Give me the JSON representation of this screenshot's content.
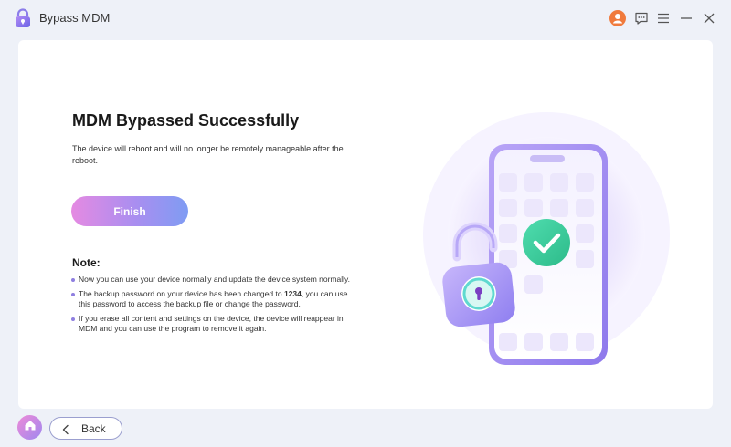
{
  "window": {
    "title": "Bypass MDM",
    "icons": [
      "lock-logo-icon",
      "user-avatar-icon",
      "feedback-chat-icon",
      "menu-icon",
      "minimize-icon",
      "close-icon"
    ]
  },
  "main": {
    "heading": "MDM Bypassed Successfully",
    "description": "The device will reboot and will no longer be remotely manageable after the reboot.",
    "finish_label": "Finish",
    "note_title": "Note:",
    "notes": [
      {
        "text": "Now you can use your device normally and update the device system normally."
      },
      {
        "before": "The backup password on your device has been changed to ",
        "bold": "1234",
        "after": ", you can use this password to access the backup file or change the password."
      },
      {
        "text": "If you erase all content and settings on the device, the device will reappear in MDM and you can use the program to remove it again."
      }
    ]
  },
  "footer": {
    "back_label": "Back"
  },
  "colors": {
    "accent_purple": "#9b86ee",
    "accent_pink": "#e58ae2",
    "accent_blue": "#7f9cf3",
    "check_green": "#3ecf9c",
    "avatar_orange": "#f07a3c",
    "background": "#eef1f8"
  }
}
